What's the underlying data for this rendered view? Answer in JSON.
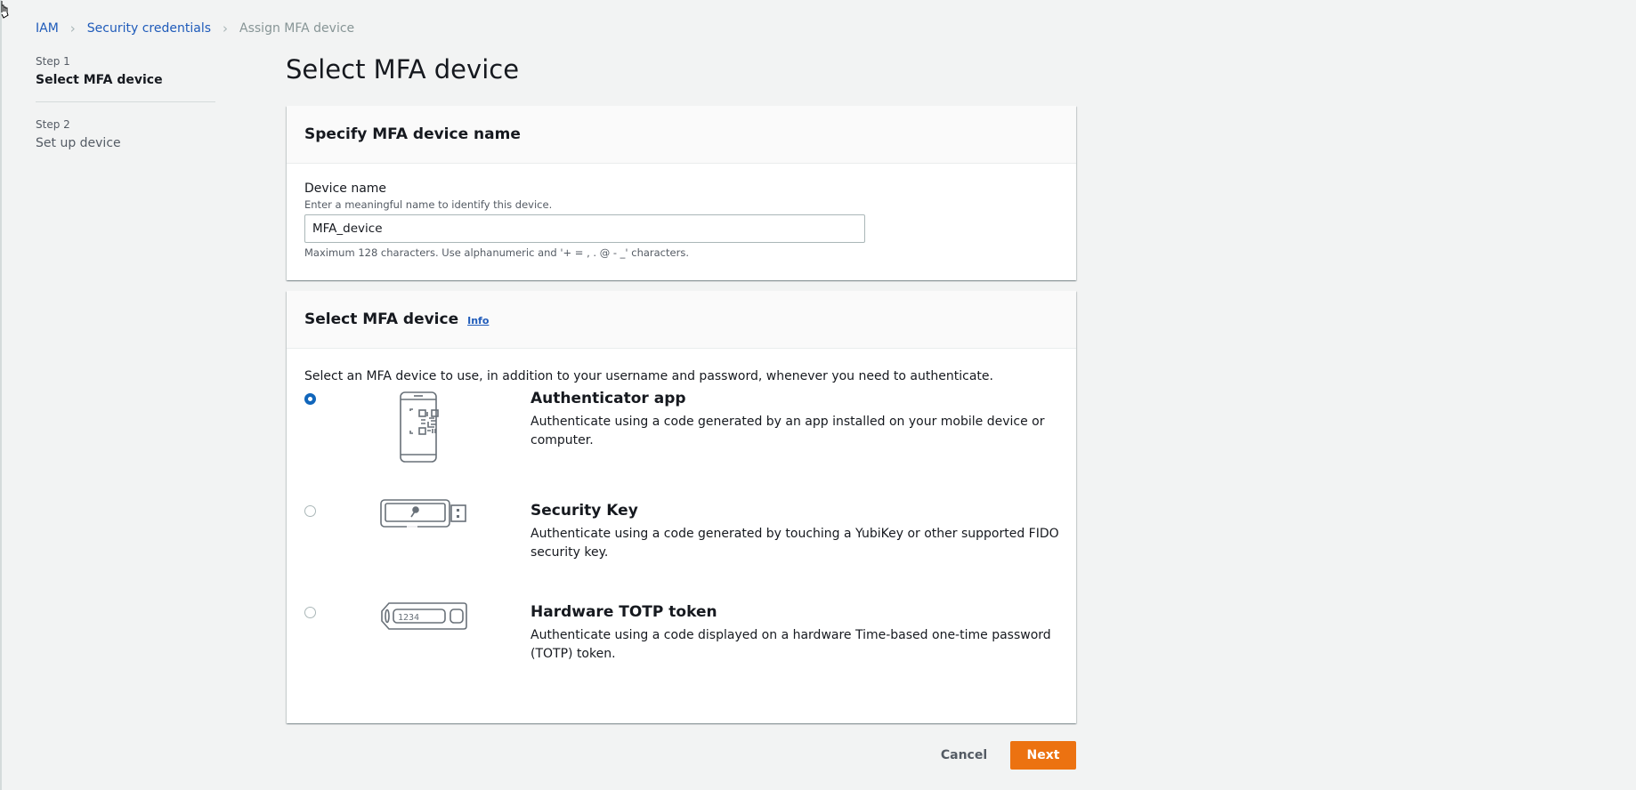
{
  "breadcrumb": {
    "items": [
      "IAM",
      "Security credentials"
    ],
    "current": "Assign MFA device"
  },
  "steps": [
    {
      "number": "Step 1",
      "title": "Select MFA device",
      "active": true
    },
    {
      "number": "Step 2",
      "title": "Set up device",
      "active": false
    }
  ],
  "page_title": "Select MFA device",
  "device_name_panel": {
    "title": "Specify MFA device name",
    "label": "Device name",
    "description": "Enter a meaningful name to identify this device.",
    "value": "MFA_device",
    "hint": "Maximum 128 characters. Use alphanumeric and '+ = , . @ - _' characters."
  },
  "device_panel": {
    "title": "Select MFA device",
    "info_label": "Info",
    "intro": "Select an MFA device to use, in addition to your username and password, whenever you need to authenticate.",
    "options": [
      {
        "title": "Authenticator app",
        "description": "Authenticate using a code generated by an app installed on your mobile device or computer.",
        "icon": "phone-qr-icon",
        "selected": true
      },
      {
        "title": "Security Key",
        "description": "Authenticate using a code generated by touching a YubiKey or other supported FIDO security key.",
        "icon": "usb-key-icon",
        "selected": false
      },
      {
        "title": "Hardware TOTP token",
        "description": "Authenticate using a code displayed on a hardware Time-based one-time password (TOTP) token.",
        "icon": "totp-token-icon",
        "selected": false,
        "token_display": "1234"
      }
    ]
  },
  "actions": {
    "cancel_label": "Cancel",
    "next_label": "Next"
  },
  "colors": {
    "primary_button": "#ec7211",
    "link": "#1f5bba",
    "radio_selected": "#1166bb",
    "background": "#f2f3f3"
  }
}
